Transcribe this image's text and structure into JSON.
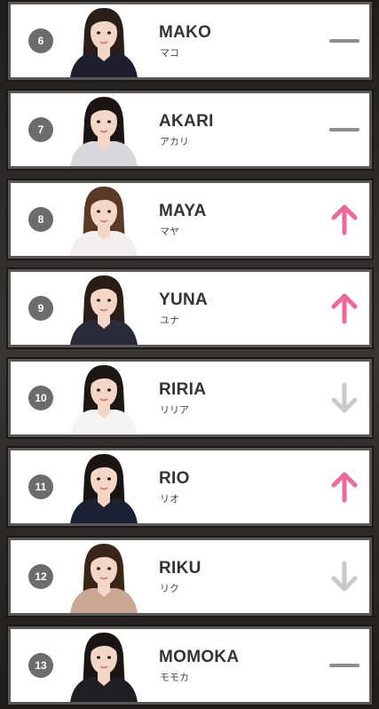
{
  "rankings": [
    {
      "rank": "6",
      "name": "MAKO",
      "kana": "マコ",
      "trend": "same",
      "photo": "member-photo"
    },
    {
      "rank": "7",
      "name": "AKARI",
      "kana": "アカリ",
      "trend": "same",
      "photo": "member-photo"
    },
    {
      "rank": "8",
      "name": "MAYA",
      "kana": "マヤ",
      "trend": "up",
      "photo": "member-photo"
    },
    {
      "rank": "9",
      "name": "YUNA",
      "kana": "ユナ",
      "trend": "up",
      "photo": "member-photo"
    },
    {
      "rank": "10",
      "name": "RIRIA",
      "kana": "リリア",
      "trend": "down",
      "photo": "member-photo"
    },
    {
      "rank": "11",
      "name": "RIO",
      "kana": "リオ",
      "trend": "up",
      "photo": "member-photo"
    },
    {
      "rank": "12",
      "name": "RIKU",
      "kana": "リク",
      "trend": "down",
      "photo": "member-photo"
    },
    {
      "rank": "13",
      "name": "MOMOKA",
      "kana": "モモカ",
      "trend": "same",
      "photo": "member-photo"
    }
  ],
  "colors": {
    "up": "#f2679a",
    "down": "#c9c9c9",
    "same": "#8c8c8c",
    "badge": "#6c6c6c"
  }
}
